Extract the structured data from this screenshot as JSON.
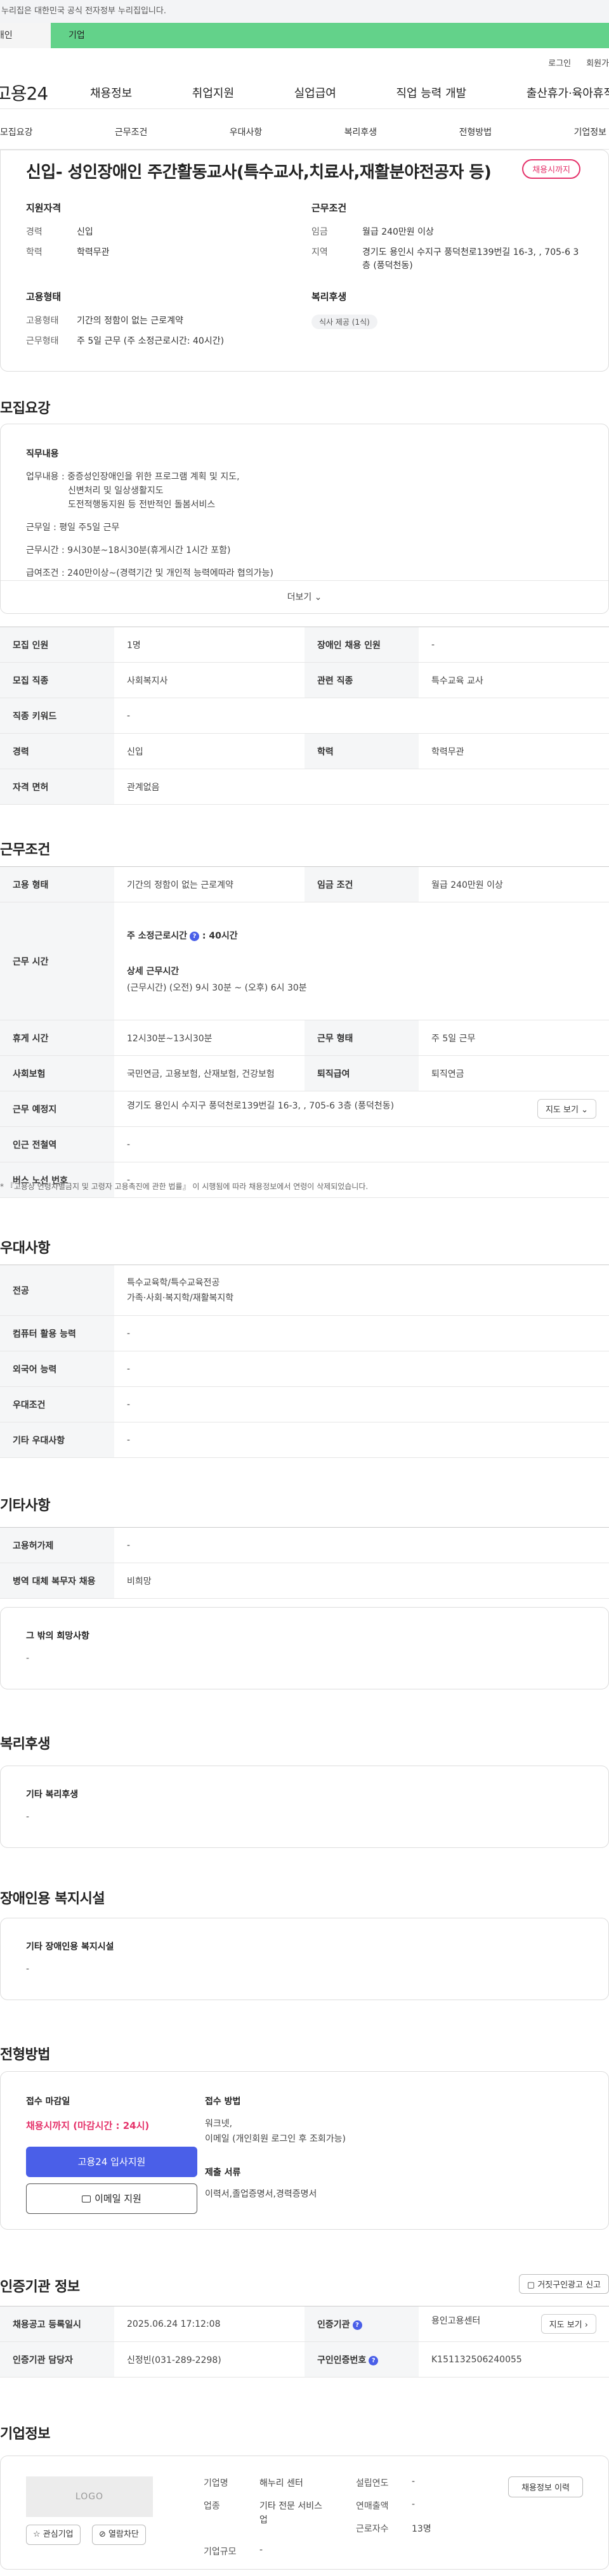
{
  "gov_banner": "이 누리집은 대한민국 공식 전자정부 누리집입니다.",
  "user_tabs": {
    "personal": "개인",
    "corporate": "기업"
  },
  "util": {
    "login": "로그인",
    "signup": "회원가입"
  },
  "logo": "고용24",
  "gnb": [
    "채용정보",
    "취업지원",
    "실업급여",
    "직업 능력 개발",
    "출산휴가·육아휴직"
  ],
  "anchors": [
    "모집요강",
    "근무조건",
    "우대사항",
    "복리후생",
    "전형방법",
    "기업정보"
  ],
  "summary": {
    "title": "신입- 성인장애인 주간활동교사(특수교사,치료사,재활분야전공자 등)",
    "status": "채용시까지",
    "qualification": {
      "heading": "지원자격",
      "career_label": "경력",
      "career": "신입",
      "edu_label": "학력",
      "edu": "학력무관"
    },
    "conditions": {
      "heading": "근무조건",
      "wage_label": "임금",
      "wage": "월급 240만원 이상",
      "region_label": "지역",
      "region": "경기도 용인시 수지구 풍덕천로139번길 16-3, , 705-6 3층 (풍덕천동)"
    },
    "employment": {
      "heading": "고용형태",
      "type_label": "고용형태",
      "type": "기간의 정함이 없는 근로계약",
      "form_label": "근무형태",
      "form": "주 5일 근무 (주 소정근로시간: 40시간)"
    },
    "benefits": {
      "heading": "복리후생",
      "tag": "식사 제공 (1식)"
    }
  },
  "recruit": {
    "section_title": "모집요강",
    "duty_heading": "직무내용",
    "duty_lines": [
      "업무내용 : 중증성인장애인을 위한 프로그램 계획 및 지도,",
      "            신변처리 및 일상생활지도",
      "            도전적행동지원 등 전반적인 돌봄서비스",
      "",
      "근무일 : 평일 주5일 근무",
      "",
      "근무시간 : 9시30분~18시30분(휴게시간 1시간 포함)",
      "",
      "급여조건 : 240만이상~(경력기간 및 개인적 능력에따라 협의가능)"
    ],
    "more": "더보기",
    "rows": [
      [
        "모집 인원",
        "1명",
        "장애인 채용 인원",
        "-"
      ],
      [
        "모집 직종",
        "사회복지사",
        "관련 직종",
        "특수교육 교사"
      ],
      [
        "직종 키워드",
        "-",
        "",
        ""
      ],
      [
        "경력",
        "신입",
        "학력",
        "학력무관"
      ],
      [
        "자격 면허",
        "관계없음",
        "",
        ""
      ]
    ]
  },
  "work": {
    "section_title": "근무조건",
    "type_label": "고용 형태",
    "type": "기간의 정함이 없는 근로계약",
    "wage_label": "임금 조건",
    "wage": "월급 240만원 이상",
    "hours_label": "근무 시간",
    "hours_weekly": "주 소정근로시간",
    "hours_weekly_value": ": 40시간",
    "hours_detail_label": "상세 근무시간",
    "hours_detail": "(근무시간) (오전) 9시 30분 ~ (오후) 6시 30분",
    "break_label": "휴게 시간",
    "break": "12시30분~13시30분",
    "form_label": "근무 형태",
    "form": "주 5일 근무",
    "insurance_label": "사회보험",
    "insurance": "국민연금, 고용보험, 산재보험, 건강보험",
    "retire_label": "퇴직급여",
    "retire": "퇴직연금",
    "place_label": "근무 예정지",
    "place": "경기도 용인시 수지구 풍덕천로139번길 16-3, , 705-6 3층 (풍덕천동)",
    "map_btn": "지도 보기",
    "subway_label": "인근 전철역",
    "subway": "-",
    "bus_label": "버스 노선 번호",
    "bus": "-",
    "note": "* 『고용상 연령차별금지 및 고령자 고용촉진에 관한 법률』 이 시행됨에 따라 채용정보에서 연령이 삭제되었습니다."
  },
  "preferred": {
    "section_title": "우대사항",
    "major_label": "전공",
    "major1": "특수교육학/특수교육전공",
    "major2": "가족·사회·복지학/재활복지학",
    "computer_label": "컴퓨터 활용 능력",
    "computer": "-",
    "lang_label": "외국어 능력",
    "lang": "-",
    "cond_label": "우대조건",
    "cond": "-",
    "etc_label": "기타 우대사항",
    "etc": "-"
  },
  "others": {
    "section_title": "기타사항",
    "insurance_label": "고용허가제",
    "insurance": "-",
    "military_label": "병역 대체 복무자 채용",
    "military": "비희망",
    "wish_heading": "그 밖의 희망사항",
    "wish": "-"
  },
  "welfare": {
    "section_title": "복리후생",
    "heading": "기타 복리후생",
    "value": "-"
  },
  "disabled": {
    "section_title": "장애인용 복지시설",
    "heading": "기타 장애인용 복지시설",
    "value": "-"
  },
  "apply": {
    "section_title": "전형방법",
    "deadline_heading": "접수 마감일",
    "deadline": "채용시까지 (마감시간 : 24시)",
    "btn_apply": "고용24 입사지원",
    "btn_email": "이메일 지원",
    "method_heading": "접수 방법",
    "method_line1": "워크넷,",
    "method_line2": "이메일 (개인회원 로그인 후 조회가능)",
    "docs_heading": "제출 서류",
    "docs": "이력서,졸업증명서,경력증명서"
  },
  "cert": {
    "section_title": "인증기관 정보",
    "report_btn": "거짓구인광고 신고",
    "reg_label": "채용공고 등록일시",
    "reg": "2025.06.24 17:12:08",
    "agency_label": "인증기관",
    "agency": "용인고용센터",
    "map_btn": "지도 보기",
    "manager_label": "인증기관 담당자",
    "manager": "신정빈(031-289-2298)",
    "id_label": "구인인증번호",
    "id": "K151132506240055"
  },
  "company": {
    "section_title": "기업정보",
    "logo_text": "LOGO",
    "fav_btn": "관심기업",
    "block_btn": "열람차단",
    "name_label": "기업명",
    "name": "해누리 센터",
    "industry_label": "업종",
    "industry1": "기타 전문 서비스",
    "industry2": "업",
    "size_label": "기업규모",
    "size": "-",
    "est_label": "설립연도",
    "est": "-",
    "sales_label": "연매출액",
    "sales": "-",
    "emp_label": "근로자수",
    "emp": "13명",
    "history_btn": "채용정보 이력"
  }
}
